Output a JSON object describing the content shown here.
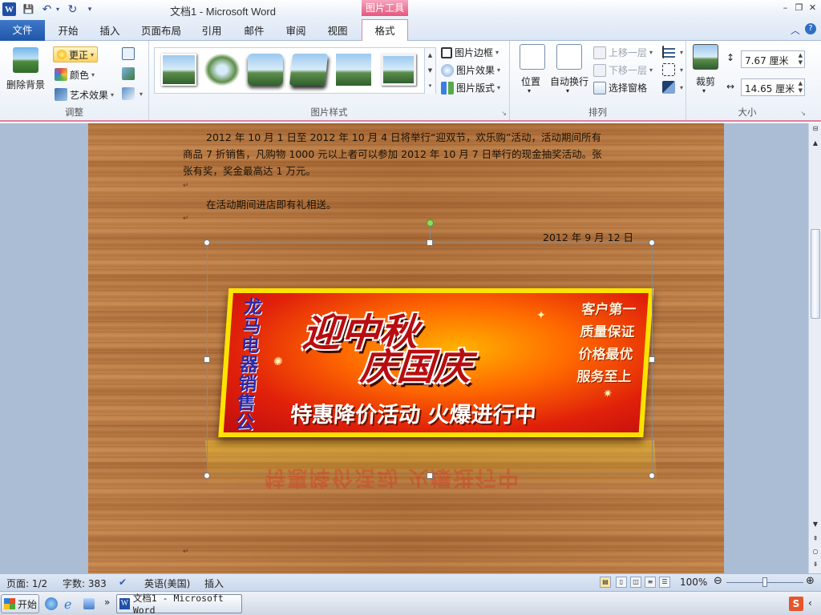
{
  "window": {
    "app_icon": "W",
    "title": "文档1 - Microsoft Word",
    "context_tab_group": "图片工具",
    "controls": [
      "–",
      "❐",
      "✕"
    ]
  },
  "quick_access": {
    "save": "💾",
    "undo": "↶",
    "redo": "↻",
    "customize": "▾"
  },
  "tabs": {
    "file": "文件",
    "items": [
      "开始",
      "插入",
      "页面布局",
      "引用",
      "邮件",
      "审阅",
      "视图"
    ],
    "active": "格式"
  },
  "ribbon": {
    "adjust": {
      "label": "调整",
      "remove_bg": "删除背景",
      "corrections": "更正",
      "color": "颜色",
      "artistic": "艺术效果"
    },
    "styles": {
      "label": "图片样式",
      "border": "图片边框",
      "effects": "图片效果",
      "layout": "图片版式"
    },
    "arrange": {
      "label": "排列",
      "position": "位置",
      "wrap": "自动换行",
      "bring_forward": "上移一层",
      "send_backward": "下移一层",
      "selection_pane": "选择窗格"
    },
    "size": {
      "label": "大小",
      "crop": "裁剪",
      "height": "7.67 厘米",
      "width": "14.65 厘米"
    }
  },
  "document": {
    "line1": "2012 年 10 月 1 日至 2012 年 10 月 4 日将举行“迎双节，欢乐购”活动，活动期间所有",
    "line2": "商品 7 折销售，凡购物 1000 元以上者可以参加 2012 年 10 月 7 日举行的现金抽奖活动。张",
    "line3": "张有奖，奖金最高达 1 万元。",
    "line4": "在活动期间进店即有礼相送。",
    "date": "2012 年 9 月 12 日",
    "para_mark": "↵"
  },
  "banner": {
    "store_name": "龙马电器销售公司",
    "title_line1": "迎中秋",
    "title_line2": "庆国庆",
    "subtitle": "特惠降价活动  火爆进行中",
    "slogans": [
      "客户第一",
      "质量保证",
      "价格最优",
      "服务至上"
    ]
  },
  "statusbar": {
    "page": "页面: 1/2",
    "words": "字数: 383",
    "language": "英语(美国)",
    "mode": "插入",
    "zoom": "100%"
  },
  "taskbar": {
    "start": "开始",
    "word_task": "文档1 - Microsoft Word"
  },
  "colors": {
    "accent_context": "#e7557e",
    "file_tab": "#1e56a8",
    "banner_red": "#c00d10",
    "banner_yellow": "#ffe200",
    "wood": "#b9773f"
  }
}
